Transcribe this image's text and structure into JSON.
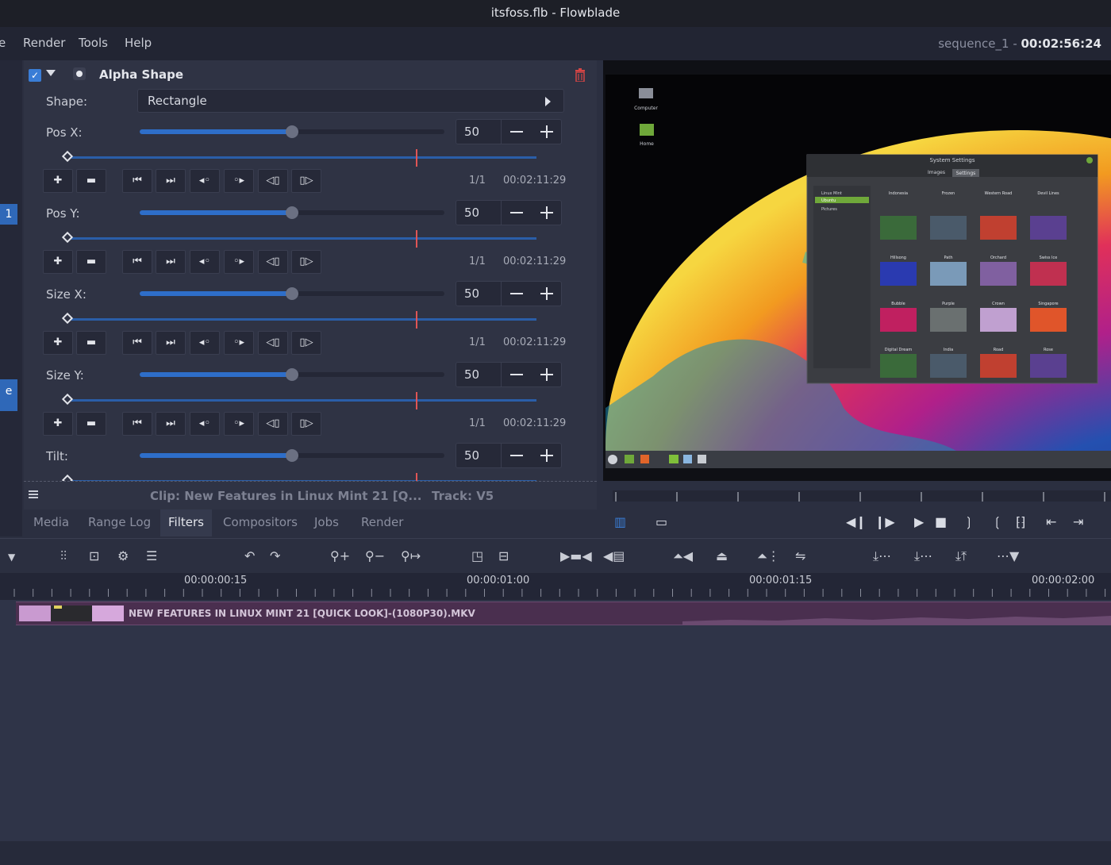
{
  "window": {
    "title": "itsfoss.flb - Flowblade"
  },
  "menu": {
    "items": [
      "e",
      "Render",
      "Tools",
      "Help"
    ]
  },
  "sequence": {
    "name": "sequence_1",
    "separator": " - ",
    "duration": "00:02:56:24"
  },
  "side_tabs": [
    "1",
    "e"
  ],
  "filter": {
    "title": "Alpha Shape",
    "enabled": true,
    "shape_label": "Shape:",
    "shape_value": "Rectangle",
    "params": [
      {
        "label": "Pos X:",
        "value": "50",
        "fraction": 0.5,
        "kf_count": "1/1",
        "timecode": "00:02:11:29"
      },
      {
        "label": "Pos Y:",
        "value": "50",
        "fraction": 0.5,
        "kf_count": "1/1",
        "timecode": "00:02:11:29"
      },
      {
        "label": "Size X:",
        "value": "50",
        "fraction": 0.5,
        "kf_count": "1/1",
        "timecode": "00:02:11:29"
      },
      {
        "label": "Size Y:",
        "value": "50",
        "fraction": 0.5,
        "kf_count": "1/1",
        "timecode": "00:02:11:29"
      },
      {
        "label": "Tilt:",
        "value": "50",
        "fraction": 0.5
      }
    ]
  },
  "status": {
    "clip": "Clip: New Features in Linux Mint 21 [Q...",
    "track": "Track: V5"
  },
  "tabs": [
    {
      "label": "Media",
      "active": false
    },
    {
      "label": "Range Log",
      "active": false
    },
    {
      "label": "Filters",
      "active": true
    },
    {
      "label": "Compositors",
      "active": false
    },
    {
      "label": "Jobs",
      "active": false
    },
    {
      "label": "Render",
      "active": false
    }
  ],
  "timeline": {
    "labels": [
      "00:00:00:15",
      "00:00:01:00",
      "00:00:01:15",
      "00:00:02:00"
    ],
    "clip_name": "NEW FEATURES IN LINUX MINT 21 [QUICK LOOK]-(1080P30).MKV"
  },
  "preview": {
    "window_title": "System Settings",
    "tabs": [
      "Images",
      "Settings"
    ],
    "sidebar": [
      "Linux Mint",
      "Ubuntu",
      "Pictures"
    ],
    "tiles": [
      "Indonesia",
      "Frozen",
      "Western Road",
      "Devil Lines",
      "Hillsong",
      "Path",
      "Orchard",
      "Swiss Ice",
      "Bubble",
      "Purple",
      "Crown",
      "Singapore",
      "Digital Dream",
      "India",
      "Road",
      "Rose"
    ],
    "desktop_icons": [
      "Computer",
      "Home"
    ]
  },
  "colors": {
    "accent": "#2e6ec9",
    "playhead": "#e05555",
    "clip": "#4a2f4f"
  }
}
